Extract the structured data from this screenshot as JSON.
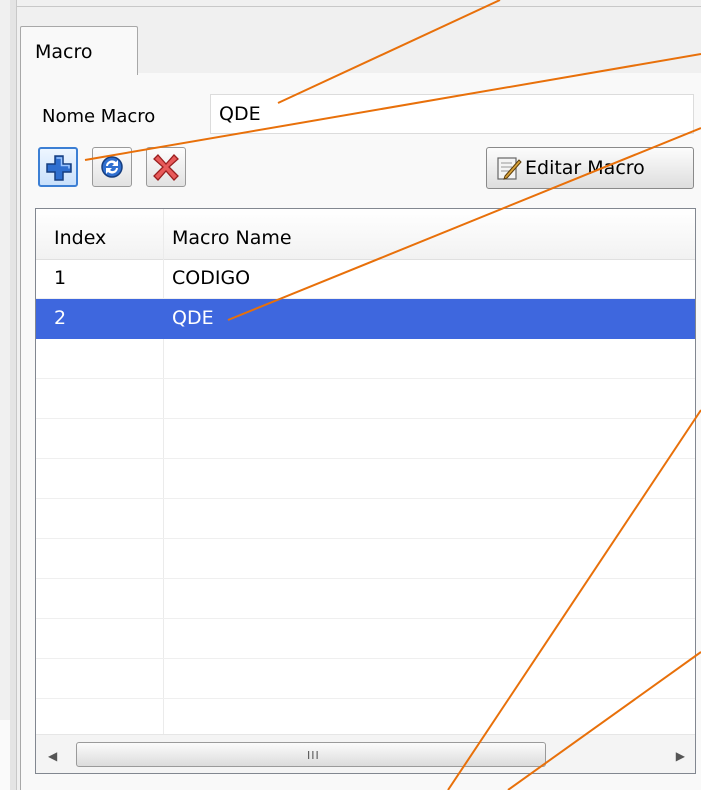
{
  "tab": {
    "label": "Macro"
  },
  "form": {
    "nome_label": "Nome Macro",
    "nome_value": "QDE"
  },
  "toolbar": {
    "add_icon": "plus-icon",
    "refresh_icon": "refresh-icon",
    "delete_icon": "delete-x-icon",
    "edit_label": "Editar Macro"
  },
  "table": {
    "columns": [
      "Index",
      "Macro Name"
    ],
    "rows": [
      {
        "index": "1",
        "name": "CODIGO",
        "selected": false
      },
      {
        "index": "2",
        "name": "QDE",
        "selected": true
      }
    ],
    "scroll_grip": "III"
  },
  "colors": {
    "selection": "#3e67de",
    "annotation_line": "#e8700a"
  }
}
